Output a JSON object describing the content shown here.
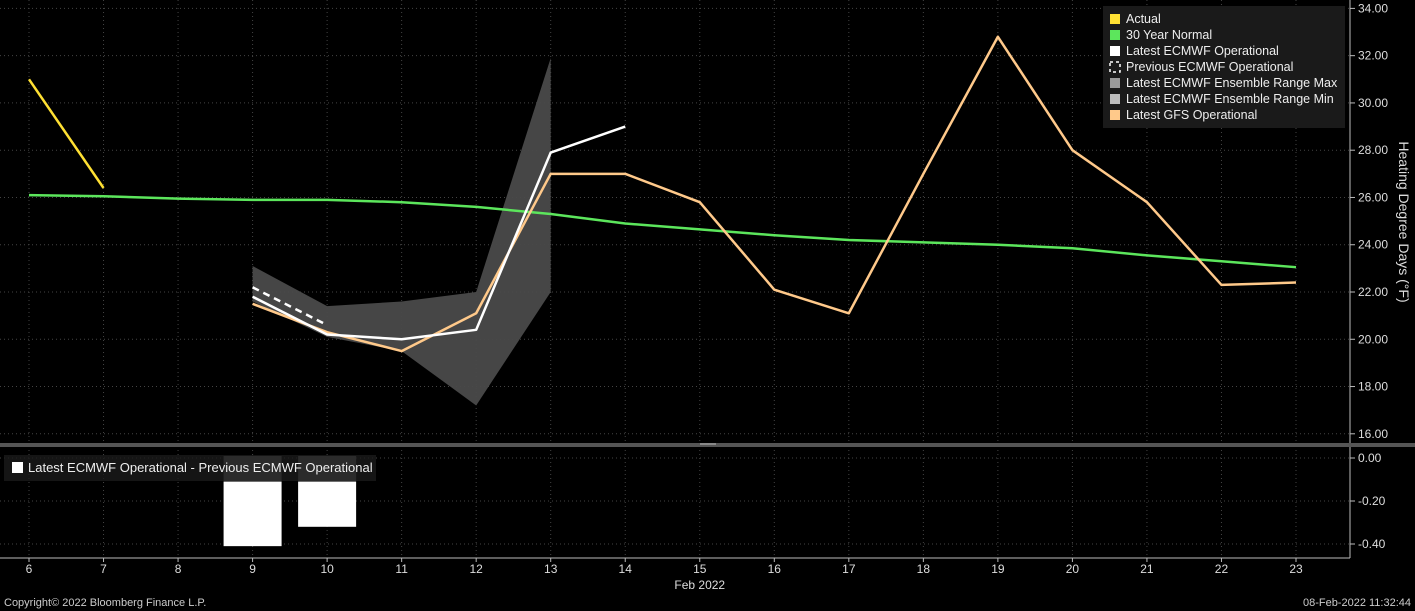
{
  "chart_data": [
    {
      "type": "line",
      "x_label": "Feb 2022",
      "x_ticks": [
        "6",
        "7",
        "8",
        "9",
        "10",
        "11",
        "12",
        "13",
        "14",
        "15",
        "16",
        "17",
        "18",
        "19",
        "20",
        "21",
        "22",
        "23"
      ],
      "xlim": [
        6,
        23
      ],
      "ylabel": "Heating Degree Days (°F)",
      "ylim": [
        15.5,
        34.4
      ],
      "y_ticks": [
        "16.00",
        "18.00",
        "20.00",
        "22.00",
        "24.00",
        "26.00",
        "28.00",
        "30.00",
        "32.00",
        "34.00"
      ],
      "grid": true,
      "legend_position": "top-right",
      "series": [
        {
          "name": "Actual",
          "color": "#ffe033",
          "x": [
            6,
            7
          ],
          "y": [
            31.0,
            26.4
          ]
        },
        {
          "name": "30 Year Normal",
          "color": "#5ce65c",
          "x": [
            6,
            7,
            8,
            9,
            10,
            11,
            12,
            13,
            14,
            15,
            16,
            17,
            18,
            19,
            20,
            21,
            22,
            23
          ],
          "y": [
            26.1,
            26.05,
            25.95,
            25.9,
            25.9,
            25.8,
            25.6,
            25.3,
            24.9,
            24.65,
            24.4,
            24.2,
            24.1,
            24.0,
            23.85,
            23.55,
            23.3,
            23.05
          ]
        },
        {
          "name": "Latest ECMWF Operational",
          "color": "#ffffff",
          "x": [
            9,
            10,
            11,
            12,
            13,
            14
          ],
          "y": [
            21.8,
            20.2,
            20.0,
            20.4,
            27.9,
            29.0
          ]
        },
        {
          "name": "Previous ECMWF Operational",
          "color": "#ffffff",
          "dashed": true,
          "x": [
            9,
            10
          ],
          "y": [
            22.2,
            20.6
          ]
        },
        {
          "name": "Latest ECMWF Ensemble Range Max",
          "color": "#9a9a9a",
          "x": [
            9,
            10,
            11,
            12,
            13
          ],
          "y": [
            23.1,
            21.4,
            21.6,
            22.0,
            31.9
          ]
        },
        {
          "name": "Latest ECMWF Ensemble Range Min",
          "color": "#bdbdbd",
          "x": [
            9,
            10,
            11,
            12,
            13
          ],
          "y": [
            21.6,
            20.1,
            19.5,
            17.2,
            22.0
          ]
        },
        {
          "name": "Latest GFS Operational",
          "color": "#ffc98a",
          "x": [
            9,
            10,
            11,
            12,
            13,
            14,
            15,
            16,
            17,
            18,
            19,
            20,
            21,
            22,
            23
          ],
          "y": [
            21.5,
            20.3,
            19.5,
            21.1,
            27.0,
            27.0,
            25.8,
            22.1,
            21.1,
            27.0,
            32.8,
            28.0,
            25.8,
            22.3,
            22.4
          ]
        }
      ]
    },
    {
      "type": "bar",
      "legend": "Latest ECMWF Operational - Previous ECMWF Operational",
      "color": "#ffffff",
      "x": [
        9,
        10
      ],
      "values": [
        -0.41,
        -0.32
      ],
      "ylim": [
        -0.47,
        0.03
      ],
      "y_ticks": [
        "0.00",
        "-0.20",
        "-0.40"
      ]
    }
  ],
  "footer": {
    "copyright": "Copyright© 2022 Bloomberg Finance L.P.",
    "timestamp": "08-Feb-2022 11:32:44"
  }
}
